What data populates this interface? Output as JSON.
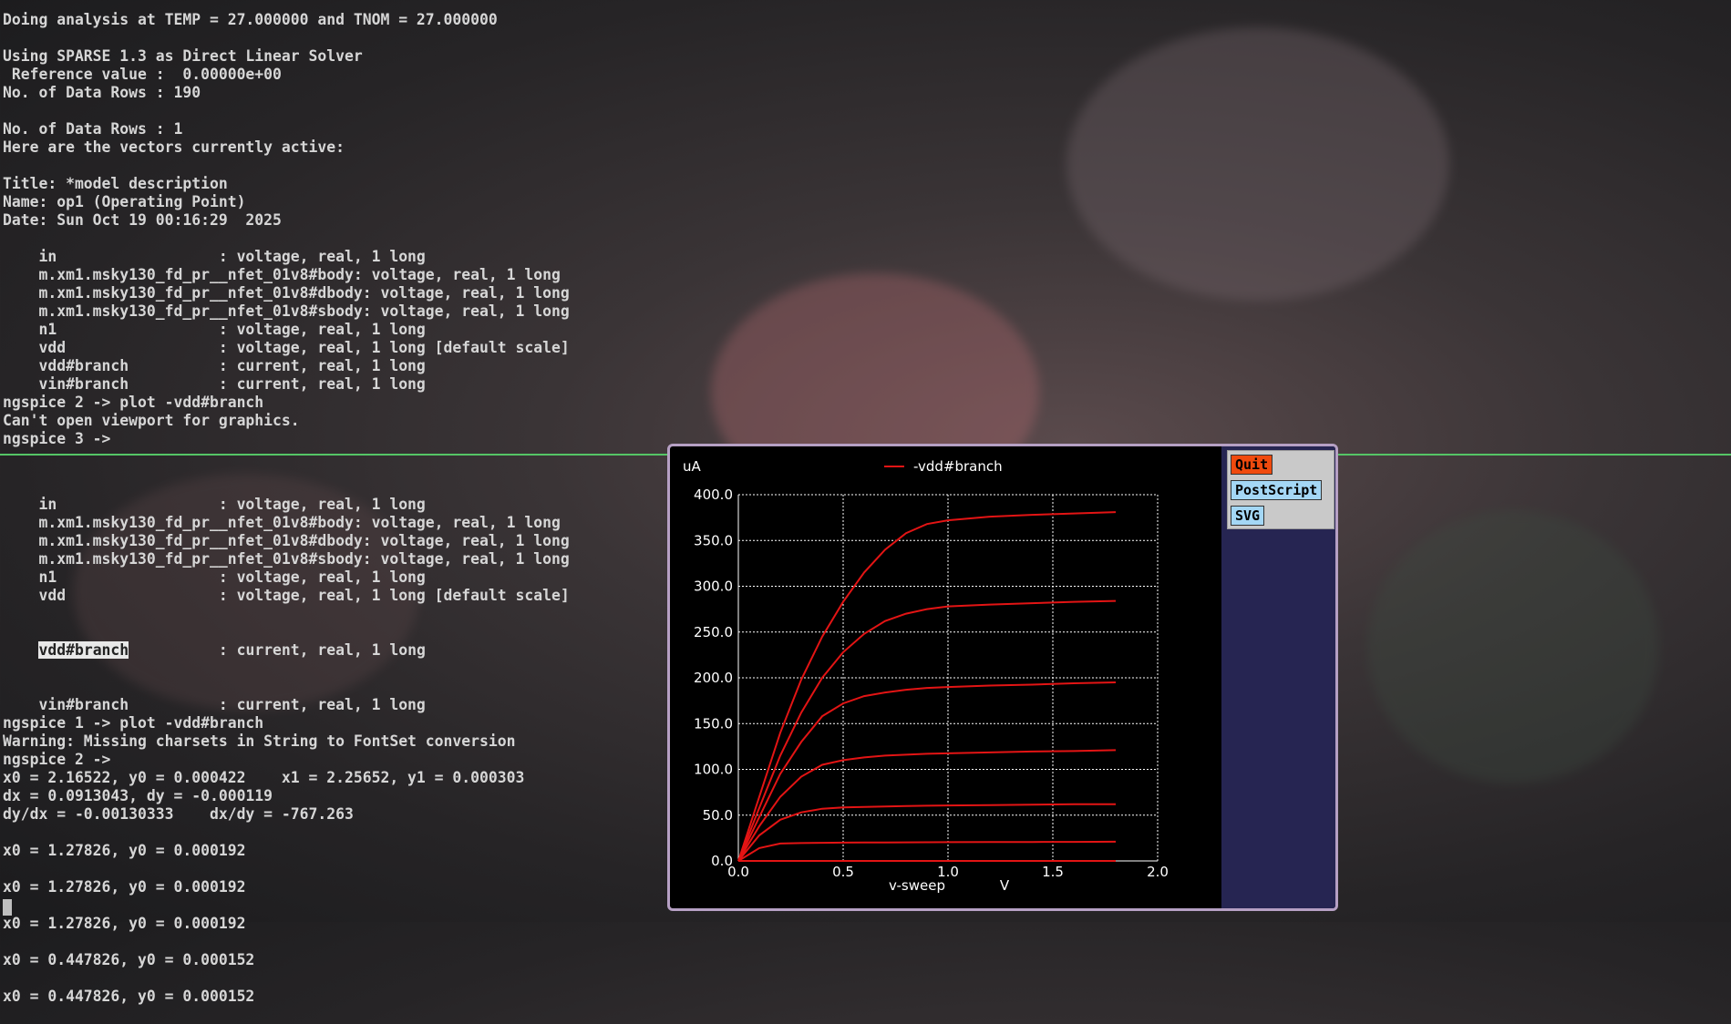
{
  "terminal_top": [
    "Doing analysis at TEMP = 27.000000 and TNOM = 27.000000",
    "",
    "Using SPARSE 1.3 as Direct Linear Solver",
    " Reference value :  0.00000e+00",
    "No. of Data Rows : 190",
    "",
    "No. of Data Rows : 1",
    "Here are the vectors currently active:",
    "",
    "Title: *model description",
    "Name: op1 (Operating Point)",
    "Date: Sun Oct 19 00:16:29  2025",
    "",
    "    in                  : voltage, real, 1 long",
    "    m.xm1.msky130_fd_pr__nfet_01v8#body: voltage, real, 1 long",
    "    m.xm1.msky130_fd_pr__nfet_01v8#dbody: voltage, real, 1 long",
    "    m.xm1.msky130_fd_pr__nfet_01v8#sbody: voltage, real, 1 long",
    "    n1                  : voltage, real, 1 long",
    "    vdd                 : voltage, real, 1 long [default scale]",
    "    vdd#branch          : current, real, 1 long",
    "    vin#branch          : current, real, 1 long",
    "ngspice 2 -> plot -vdd#branch",
    "Can't open viewport for graphics.",
    "ngspice 3 ->"
  ],
  "terminal_bottom": {
    "before": [
      "    in                  : voltage, real, 1 long",
      "    m.xm1.msky130_fd_pr__nfet_01v8#body: voltage, real, 1 long",
      "    m.xm1.msky130_fd_pr__nfet_01v8#dbody: voltage, real, 1 long",
      "    m.xm1.msky130_fd_pr__nfet_01v8#sbody: voltage, real, 1 long",
      "    n1                  : voltage, real, 1 long",
      "    vdd                 : voltage, real, 1 long [default scale]"
    ],
    "selected_indent": "    ",
    "selected_word": "vdd#branch",
    "selected_rest": "          : current, real, 1 long",
    "after": [
      "    vin#branch          : current, real, 1 long",
      "ngspice 1 -> plot -vdd#branch",
      "Warning: Missing charsets in String to FontSet conversion",
      "ngspice 2 ->",
      "x0 = 2.16522, y0 = 0.000422    x1 = 2.25652, y1 = 0.000303",
      "dx = 0.0913043, dy = -0.000119",
      "dy/dx = -0.00130333    dx/dy = -767.263",
      "",
      "x0 = 1.27826, y0 = 0.000192",
      "",
      "x0 = 1.27826, y0 = 0.000192",
      "",
      "x0 = 1.27826, y0 = 0.000192",
      "",
      "x0 = 0.447826, y0 = 0.000152",
      "",
      "x0 = 0.447826, y0 = 0.000152"
    ]
  },
  "plot_window": {
    "buttons": {
      "quit": "Quit",
      "postscript": "PostScript",
      "svg": "SVG"
    }
  },
  "colors": {
    "trace": "#e31414",
    "grid": "#ffffff",
    "plot_bg": "#000000",
    "panel": "#262552",
    "prompt_divider": "#55c566"
  },
  "chart_data": {
    "type": "line",
    "title": "",
    "xlabel": "v-sweep",
    "xunit": "V",
    "ylabel": "uA",
    "xlim": [
      0.0,
      2.0
    ],
    "ylim": [
      0.0,
      400.0
    ],
    "xticks": [
      "0.0",
      "0.5",
      "1.0",
      "1.5",
      "2.0"
    ],
    "yticks": [
      "0.0",
      "50.0",
      "100.0",
      "150.0",
      "200.0",
      "250.0",
      "300.0",
      "350.0",
      "400.0"
    ],
    "grid": true,
    "legend": [
      "-vdd#branch"
    ],
    "legend_position": "top-center",
    "x": [
      0.0,
      0.1,
      0.2,
      0.3,
      0.4,
      0.5,
      0.6,
      0.7,
      0.8,
      0.9,
      1.0,
      1.2,
      1.4,
      1.6,
      1.8
    ],
    "series": [
      {
        "values": [
          0,
          0,
          0,
          0,
          0,
          0,
          0,
          0,
          0,
          0,
          0,
          0,
          0,
          0,
          0
        ]
      },
      {
        "values": [
          0,
          14,
          19,
          19.5,
          19.8,
          20,
          20.1,
          20.2,
          20.3,
          20.4,
          20.5,
          20.6,
          20.7,
          20.8,
          21
        ]
      },
      {
        "values": [
          0,
          28,
          45,
          53,
          57,
          58.5,
          59,
          59.5,
          60,
          60.3,
          60.6,
          61,
          61.5,
          62,
          62
        ]
      },
      {
        "values": [
          0,
          38,
          70,
          92,
          105,
          110,
          113,
          115,
          116,
          117,
          117.5,
          118.5,
          119.5,
          120,
          121
        ]
      },
      {
        "values": [
          0,
          48,
          95,
          130,
          158,
          172,
          180,
          184,
          187,
          189,
          190,
          191.5,
          192.5,
          194,
          195
        ]
      },
      {
        "values": [
          0,
          58,
          115,
          162,
          200,
          228,
          248,
          262,
          270,
          275,
          278,
          280,
          281.5,
          283,
          284
        ]
      },
      {
        "values": [
          0,
          70,
          140,
          198,
          245,
          283,
          315,
          340,
          358,
          368,
          372,
          376,
          378,
          379.5,
          381
        ]
      }
    ]
  }
}
